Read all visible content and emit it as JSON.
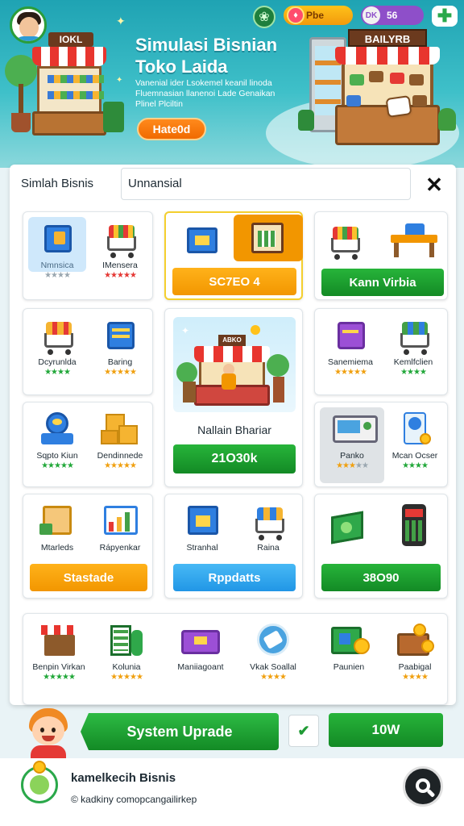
{
  "hero": {
    "title_line1": "Simulasi Bisnian",
    "title_line2": "Toko Laida",
    "description": "Vanenial ider Lsokemel keanil linoda Fluemnasian llanenoi Lade Genaikan Plinel Plciltin",
    "cta": "Hate0d",
    "shop_left_sign": "IOKL",
    "shop_right_sign": "BAILYRB",
    "currency_gold": "Pbe",
    "currency_purple": "56",
    "currency_purple_icon_text": "DK"
  },
  "toolbar": {
    "tab_label": "Simlah Bisnis",
    "search_value": "Unnansial"
  },
  "row1": {
    "card1": [
      {
        "label": "Nmnsica",
        "icon": "cube-icon",
        "rating": 4,
        "color": "#2f7fe0"
      },
      {
        "label": "IMensera",
        "icon": "cart-icon",
        "rating": 5,
        "color": "#e53935"
      }
    ],
    "card2": {
      "tiles": [
        "box-icon",
        "crate-icon"
      ],
      "button": "SC7EO 4"
    },
    "card3": {
      "tiles": [
        "cart-icon",
        "stand-icon"
      ],
      "button": "Kann Virbia"
    }
  },
  "row2": {
    "card1": [
      {
        "label": "Dcyrunlda",
        "icon": "cart-icon",
        "rating": 4
      },
      {
        "label": "Baring",
        "icon": "book-icon",
        "rating": 5
      }
    ],
    "feature": {
      "title": "Nallain Bhariar",
      "button": "21O30k",
      "shop_sign": "ABKO"
    },
    "card3": [
      {
        "label": "Sanemiema",
        "icon": "book-icon",
        "rating": 5
      },
      {
        "label": "Kemlfclien",
        "icon": "cart-icon",
        "rating": 4
      }
    ]
  },
  "row3": {
    "card1": [
      {
        "label": "Sqpto Kiun",
        "icon": "scale-icon",
        "rating": 5
      },
      {
        "label": "Dendinnede",
        "icon": "boxes-icon",
        "rating": 5
      }
    ],
    "card3": [
      {
        "label": "Panko",
        "icon": "register-icon",
        "rating": 3
      },
      {
        "label": "Mcan Ocser",
        "icon": "badge-icon",
        "rating": 4
      }
    ]
  },
  "row4": {
    "card1": {
      "items": [
        {
          "label": "Mtarleds",
          "icon": "crate-icon"
        },
        {
          "label": "Rápyenkar",
          "icon": "chart-icon"
        }
      ],
      "button": "Stastade"
    },
    "card2": {
      "items": [
        {
          "label": "Stranhal",
          "icon": "box-icon"
        },
        {
          "label": "Raina",
          "icon": "cart-icon"
        }
      ],
      "button": "Rppdatts"
    },
    "card3": {
      "items": [
        {
          "label": "",
          "icon": "cash-icon"
        },
        {
          "label": "",
          "icon": "phone-icon"
        }
      ],
      "button": "38O90"
    }
  },
  "row5": [
    {
      "label": "Benpin Virkan",
      "icon": "shop-icon",
      "rating": 5
    },
    {
      "label": "Kolunia",
      "icon": "bottle-icon",
      "rating": 5
    },
    {
      "label": "Maniiagoant",
      "icon": "chest-icon",
      "rating": 0
    },
    {
      "label": "Vkak Soallal",
      "icon": "globe-icon",
      "rating": 4
    },
    {
      "label": "Paunien",
      "icon": "safe-icon",
      "rating": 0
    },
    {
      "label": "Paabigal",
      "icon": "coin-box-icon",
      "rating": 4
    }
  ],
  "bottom": {
    "system_button": "System Uprade",
    "confirm_icon": "check-icon",
    "secondary_button": "10W"
  },
  "footer": {
    "title": "kamelkecih Bisnis",
    "subtitle": "© kadkiny comopcangailirkep"
  },
  "colors": {
    "accent_green": "#22a83a",
    "accent_orange": "#f29600",
    "accent_blue": "#2196e6",
    "hero_teal": "#1fa3b3"
  }
}
